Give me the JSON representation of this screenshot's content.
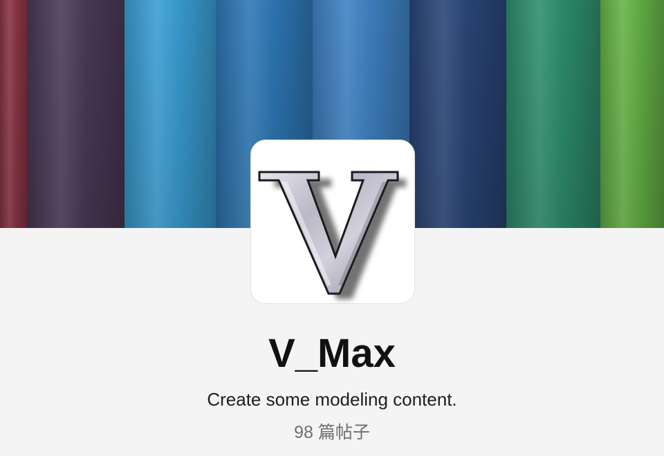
{
  "profile": {
    "name": "V_Max",
    "description": "Create some modeling content.",
    "post_count": "98",
    "post_unit": "篇帖子"
  },
  "avatar": {
    "icon": "chrome-letter-v-logo",
    "letter": "V"
  },
  "cover": {
    "description_colors": [
      "#8a3546",
      "#4b3a58",
      "#3a9ed4",
      "#2e78b6",
      "#3f82c4",
      "#2a4678",
      "#2e8f6e",
      "#66b347"
    ]
  }
}
